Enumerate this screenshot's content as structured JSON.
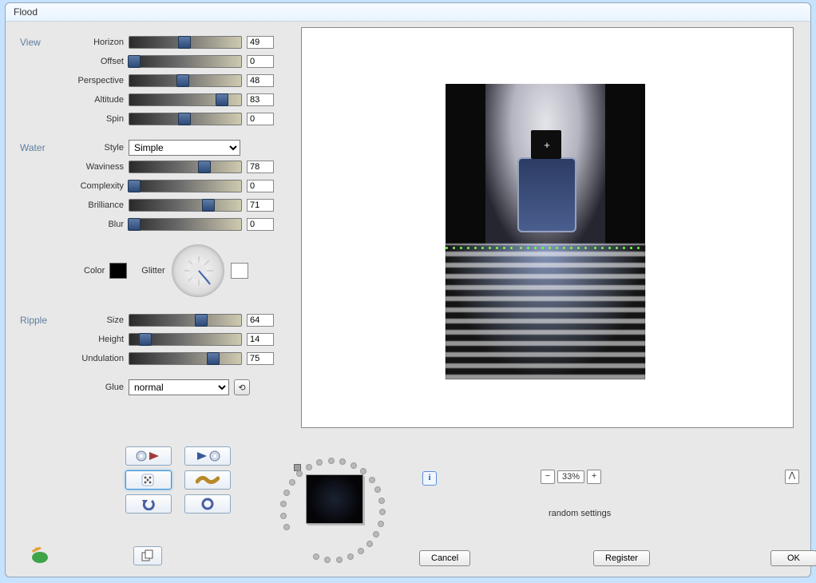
{
  "title": "Flood",
  "sections": {
    "view": {
      "label": "View",
      "sliders": {
        "horizon": {
          "label": "Horizon",
          "value": 49
        },
        "offset": {
          "label": "Offset",
          "value": 0
        },
        "perspective": {
          "label": "Perspective",
          "value": 48
        },
        "altitude": {
          "label": "Altitude",
          "value": 83
        },
        "spin": {
          "label": "Spin",
          "value": 0
        }
      }
    },
    "water": {
      "label": "Water",
      "style_label": "Style",
      "style_value": "Simple",
      "style_options": [
        "Simple"
      ],
      "sliders": {
        "waviness": {
          "label": "Waviness",
          "value": 78
        },
        "complexity": {
          "label": "Complexity",
          "value": 0
        },
        "brilliance": {
          "label": "Brilliance",
          "value": 71
        },
        "blur": {
          "label": "Blur",
          "value": 0
        }
      },
      "color_label": "Color",
      "color_value": "#000000",
      "glitter_label": "Glitter",
      "glitter_swatch": "#ffffff"
    },
    "ripple": {
      "label": "Ripple",
      "sliders": {
        "size": {
          "label": "Size",
          "value": 64
        },
        "height": {
          "label": "Height",
          "value": 14
        },
        "undulation": {
          "label": "Undulation",
          "value": 75
        }
      }
    },
    "glue": {
      "label": "Glue",
      "value": "normal",
      "options": [
        "normal"
      ]
    }
  },
  "zoom": {
    "minus": "−",
    "plus": "+",
    "value": "33%"
  },
  "status": "random settings",
  "buttons": {
    "cancel": "Cancel",
    "register": "Register",
    "ok": "OK"
  },
  "collapse_glyph": "⋀",
  "info_glyph": "i",
  "loop_glyph": "⟲"
}
